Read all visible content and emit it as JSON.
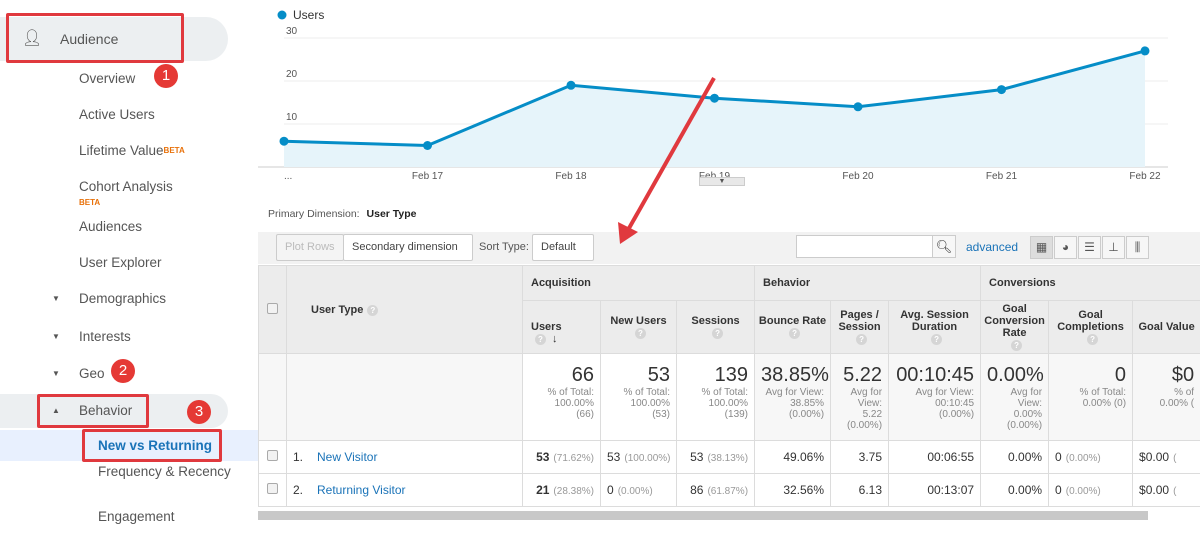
{
  "sidebar": {
    "items": [
      {
        "label": "Audience",
        "icon": "person-icon"
      },
      {
        "label": "Overview"
      },
      {
        "label": "Active Users"
      },
      {
        "label": "Lifetime Value",
        "badge": "BETA"
      },
      {
        "label": "Cohort Analysis",
        "badge": "BETA"
      },
      {
        "label": "Audiences"
      },
      {
        "label": "User Explorer"
      },
      {
        "label": "Demographics",
        "expander": "collapsed"
      },
      {
        "label": "Interests",
        "expander": "collapsed"
      },
      {
        "label": "Geo",
        "expander": "collapsed"
      },
      {
        "label": "Behavior",
        "expander": "expanded"
      },
      {
        "label": "New vs Returning",
        "selected": true
      },
      {
        "label": "Frequency & Recency"
      },
      {
        "label": "Engagement"
      }
    ],
    "annotations": [
      "1",
      "2",
      "3"
    ]
  },
  "chart_data": {
    "type": "area",
    "series": [
      {
        "name": "Users",
        "values": [
          6,
          5,
          19,
          16,
          14,
          18,
          27
        ]
      }
    ],
    "categories": [
      "...",
      "Feb 17",
      "Feb 18",
      "Feb 19",
      "Feb 20",
      "Feb 21",
      "Feb 22"
    ],
    "yticks": [
      10,
      20,
      30
    ],
    "ylim": [
      0,
      30
    ],
    "legend": "top-left",
    "color": "#058dc7"
  },
  "toolbar": {
    "primary_dimension_label": "Primary Dimension:",
    "primary_dimension_value": "User Type",
    "plot_rows": "Plot Rows",
    "secondary_dimension": "Secondary dimension",
    "sort_type_label": "Sort Type:",
    "sort_type_value": "Default",
    "search_value": "",
    "advanced": "advanced"
  },
  "table": {
    "groups": [
      "Acquisition",
      "Behavior",
      "Conversions"
    ],
    "dimension_header": "User Type",
    "columns": [
      "Users",
      "New Users",
      "Sessions",
      "Bounce Rate",
      "Pages / Session",
      "Avg. Session Duration",
      "Goal Conversion Rate",
      "Goal Completions",
      "Goal Value"
    ],
    "totals": [
      {
        "value": "66",
        "sub": [
          "% of Total:",
          "100.00%",
          "(66)"
        ]
      },
      {
        "value": "53",
        "sub": [
          "% of Total:",
          "100.00%",
          "(53)"
        ]
      },
      {
        "value": "139",
        "sub": [
          "% of Total:",
          "100.00%",
          "(139)"
        ]
      },
      {
        "value": "38.85%",
        "sub": [
          "Avg for View:",
          "38.85%",
          "(0.00%)"
        ]
      },
      {
        "value": "5.22",
        "sub": [
          "Avg for",
          "View:",
          "5.22",
          "(0.00%)"
        ]
      },
      {
        "value": "00:10:45",
        "sub": [
          "Avg for View:",
          "00:10:45",
          "(0.00%)"
        ]
      },
      {
        "value": "0.00%",
        "sub": [
          "Avg for",
          "View:",
          "0.00%",
          "(0.00%)"
        ]
      },
      {
        "value": "0",
        "sub": [
          "% of Total:",
          "0.00% (0)"
        ]
      },
      {
        "value": "$0",
        "sub": [
          "% of",
          "0.00% ("
        ]
      }
    ],
    "rows": [
      {
        "index": "1.",
        "name": "New Visitor",
        "cells": [
          [
            "53",
            "(71.62%)"
          ],
          [
            "53",
            "(100.00%)"
          ],
          [
            "53",
            "(38.13%)"
          ],
          [
            "49.06%",
            ""
          ],
          [
            "3.75",
            ""
          ],
          [
            "00:06:55",
            ""
          ],
          [
            "0.00%",
            ""
          ],
          [
            "0",
            "(0.00%)"
          ],
          [
            "$0.00",
            "("
          ]
        ]
      },
      {
        "index": "2.",
        "name": "Returning Visitor",
        "cells": [
          [
            "21",
            "(28.38%)"
          ],
          [
            "0",
            "(0.00%)"
          ],
          [
            "86",
            "(61.87%)"
          ],
          [
            "32.56%",
            ""
          ],
          [
            "6.13",
            ""
          ],
          [
            "00:13:07",
            ""
          ],
          [
            "0.00%",
            ""
          ],
          [
            "0",
            "(0.00%)"
          ],
          [
            "$0.00",
            "("
          ]
        ]
      }
    ]
  },
  "colors": {
    "accent": "#058dc7",
    "annotation": "#e0393e",
    "link": "#1a73b8"
  }
}
